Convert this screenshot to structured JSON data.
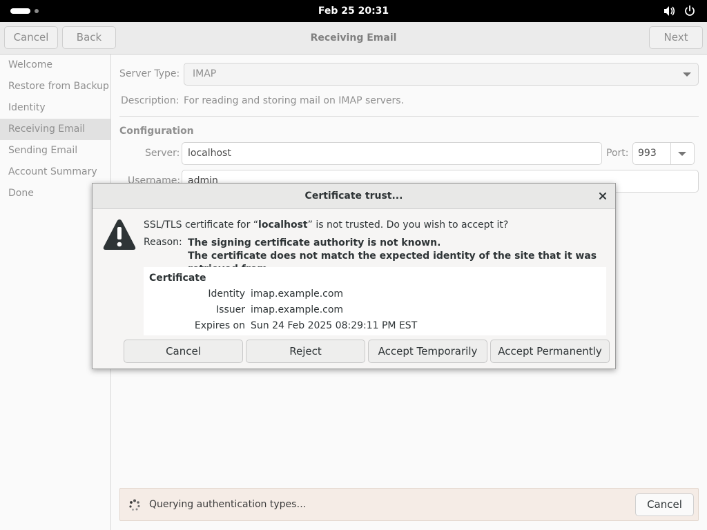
{
  "topbar": {
    "clock": "Feb 25  20:31",
    "icons": [
      "activities-indicator",
      "volume-icon",
      "power-icon"
    ]
  },
  "headerbar": {
    "cancel_label": "Cancel",
    "back_label": "Back",
    "title": "Receiving Email",
    "next_label": "Next"
  },
  "sidebar": {
    "items": [
      {
        "label": "Welcome"
      },
      {
        "label": "Restore from Backup"
      },
      {
        "label": "Identity"
      },
      {
        "label": "Receiving Email",
        "active": true
      },
      {
        "label": "Sending Email"
      },
      {
        "label": "Account Summary"
      },
      {
        "label": "Done"
      }
    ]
  },
  "form": {
    "server_type_label": "Server Type:",
    "server_type_value": "IMAP",
    "description_label": "Description:",
    "description_value": "For reading and storing mail on IMAP servers.",
    "configuration_title": "Configuration",
    "server_label": "Server:",
    "server_value": "localhost",
    "port_label": "Port:",
    "port_value": "993",
    "username_label": "Username:",
    "username_value": "admin"
  },
  "status": {
    "message": "Querying authentication types…",
    "cancel_label": "Cancel"
  },
  "dialog": {
    "title": "Certificate trust...",
    "question_prefix": "SSL/TLS certificate for “",
    "question_host": "localhost",
    "question_suffix": "” is not trusted. Do you wish to accept it?",
    "reason_label": "Reason:",
    "reason_line1": "The signing certificate authority is not known.",
    "reason_line2": "The certificate does not match the expected identity of the site that it was retrieved from.",
    "certificate": {
      "heading": "Certificate",
      "identity_label": "Identity",
      "identity_value": "imap.example.com",
      "issuer_label": "Issuer",
      "issuer_value": "imap.example.com",
      "expires_label": "Expires on",
      "expires_value": "Sun 24 Feb 2025 08:29:11 PM EST"
    },
    "buttons": {
      "cancel": "Cancel",
      "reject": "Reject",
      "accept_temporarily": "Accept Temporarily",
      "accept_permanently": "Accept Permanently"
    }
  },
  "colors": {
    "topbar_bg": "#000000",
    "status_bg": "#f5ece6",
    "sidebar_active_bg": "#e1e1e1",
    "warning_icon": "#2e3436"
  }
}
